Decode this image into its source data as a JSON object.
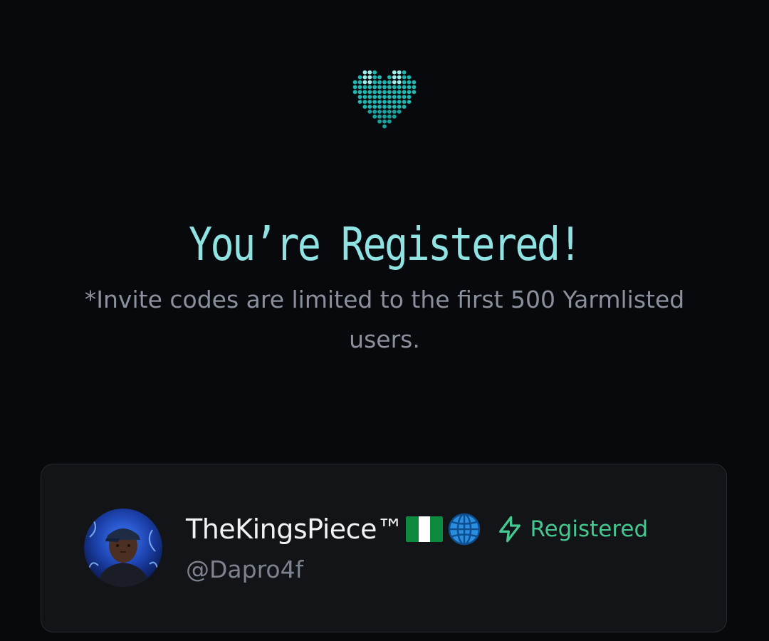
{
  "header": {
    "logo_icon": "pixel-heart-icon",
    "title": "You’re Registered!",
    "subtitle": "*Invite codes are limited to the first 500 Yarmlisted users."
  },
  "card": {
    "display_name": "TheKingsPiece™",
    "name_icons": [
      "nigeria-flag-icon",
      "globe-icon"
    ],
    "handle": "@Dapro4f",
    "status": {
      "icon": "lightning-bolt-icon",
      "label": "Registered"
    }
  },
  "colors": {
    "background": "#08090c",
    "title": "#8fe3e2",
    "accent_heart": "#1fb7b1",
    "card_bg": "#121418",
    "status_green": "#45c78f"
  }
}
